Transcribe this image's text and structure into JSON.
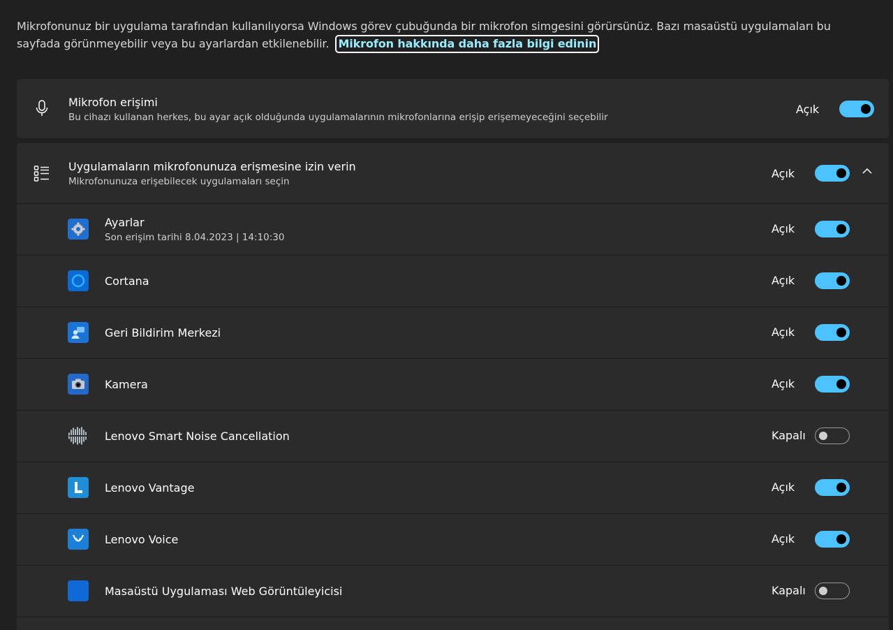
{
  "intro": {
    "text": "Mikrofonunuz bir uygulama tarafından kullanılıyorsa Windows görev çubuğunda bir mikrofon simgesini görürsünüz. Bazı masaüstü uygulamaları bu sayfada görünmeyebilir veya bu ayarlardan etkilenebilir.",
    "link": "Mikrofon hakkında daha fazla bilgi edinin"
  },
  "microphone_access": {
    "icon": "microphone-icon",
    "title": "Mikrofon erişimi",
    "subtitle": "Bu cihazı kullanan herkes, bu ayar açık olduğunda uygulamalarının mikrofonlarına erişip erişemeyeceğini seçebilir",
    "state": "Açık",
    "on": true
  },
  "apps_access": {
    "icon": "app-list-icon",
    "title": "Uygulamaların mikrofonunuza erişmesine izin verin",
    "subtitle": "Mikrofonunuza erişebilecek uygulamaları seçin",
    "state": "Açık",
    "on": true,
    "expand_icon": "chevron-up-icon"
  },
  "apps": [
    {
      "name": "Ayarlar",
      "subtitle": "Son erişim tarihi 8.04.2023  |  14:10:30",
      "state": "Açık",
      "on": true,
      "icon": "settings-gear-icon",
      "color": "#1f6fd1"
    },
    {
      "name": "Cortana",
      "subtitle": "",
      "state": "Açık",
      "on": true,
      "icon": "cortana-ring-icon",
      "color": "#0a6ad6"
    },
    {
      "name": "Geri Bildirim Merkezi",
      "subtitle": "",
      "state": "Açık",
      "on": true,
      "icon": "feedback-hub-icon",
      "color": "#1a73d9"
    },
    {
      "name": "Kamera",
      "subtitle": "",
      "state": "Açık",
      "on": true,
      "icon": "camera-icon",
      "color": "#2468c9"
    },
    {
      "name": "Lenovo Smart Noise Cancellation",
      "subtitle": "",
      "state": "Kapalı",
      "on": false,
      "icon": "noise-wave-icon",
      "color": "#2b2b2b"
    },
    {
      "name": "Lenovo Vantage",
      "subtitle": "",
      "state": "Açık",
      "on": true,
      "icon": "lenovo-vantage-icon",
      "color": "#1e8fd6"
    },
    {
      "name": "Lenovo Voice",
      "subtitle": "",
      "state": "Açık",
      "on": true,
      "icon": "lenovo-voice-icon",
      "color": "#1c7fd8"
    },
    {
      "name": "Masaüstü Uygulaması Web Görüntüleyicisi",
      "subtitle": "",
      "state": "Kapalı",
      "on": false,
      "icon": "webview-icon",
      "color": "#0f6ad8"
    }
  ]
}
